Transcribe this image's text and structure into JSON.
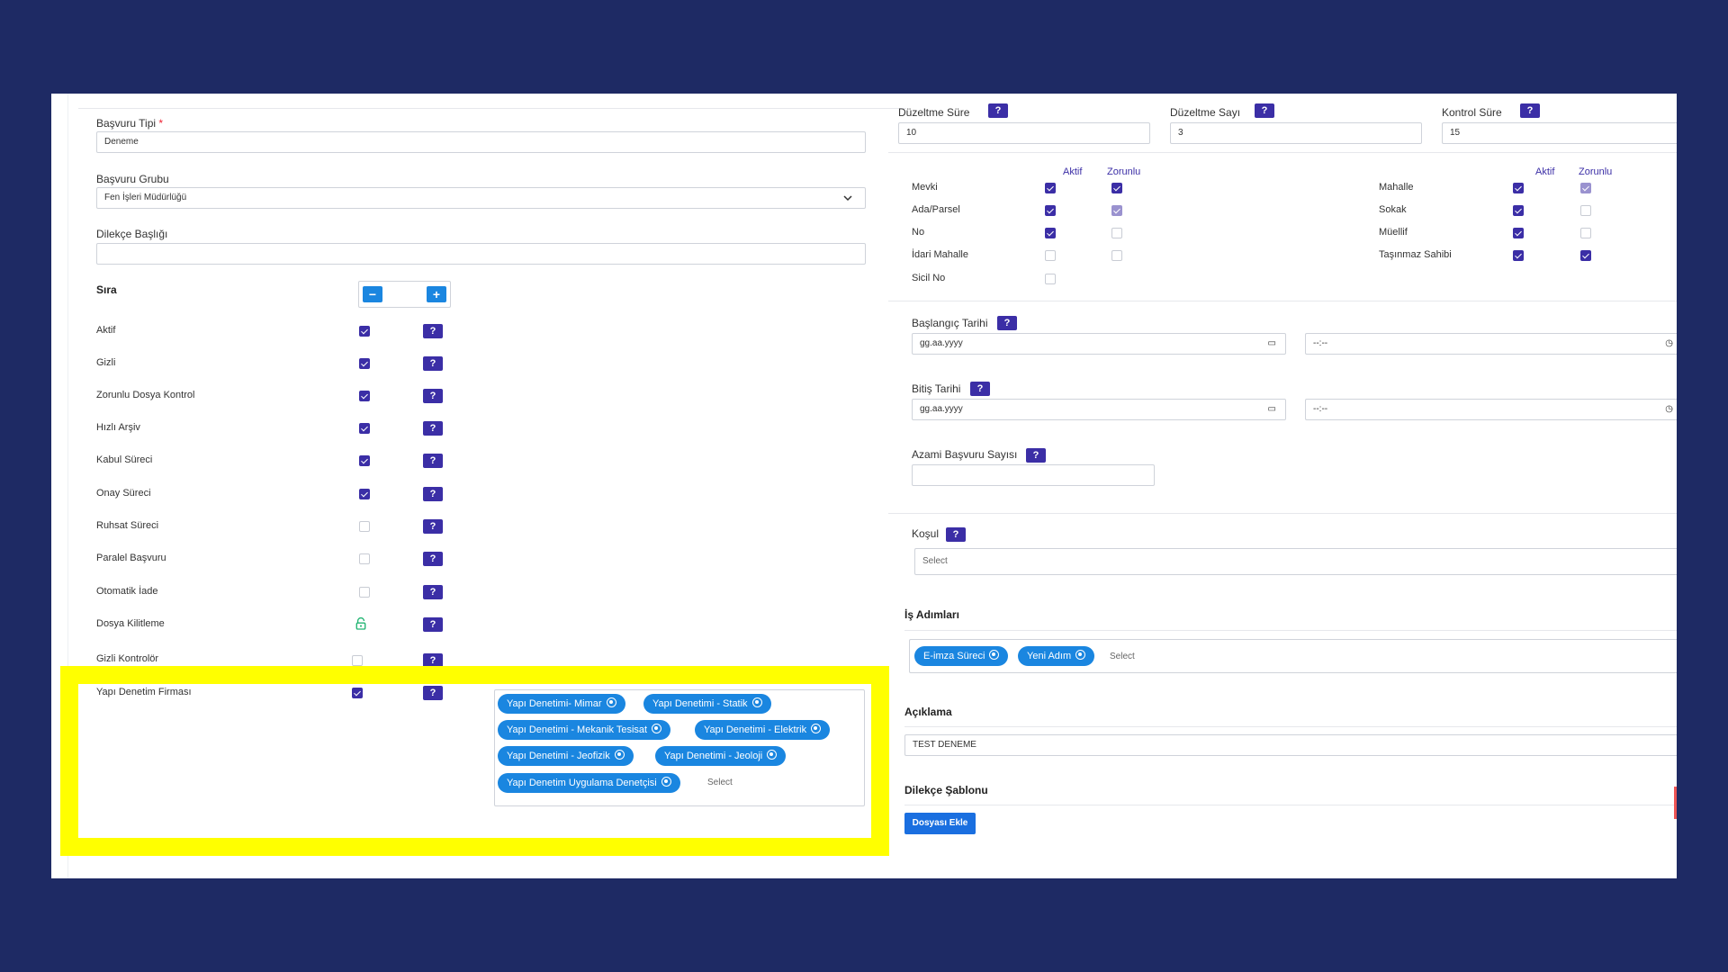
{
  "left": {
    "basvuru_tipi": {
      "label": "Başvuru Tipi",
      "required": "*",
      "value": "Deneme"
    },
    "basvuru_grubu": {
      "label": "Başvuru Grubu",
      "value": "Fen İşleri Müdürlüğü"
    },
    "dilekce_basligi": {
      "label": "Dilekçe Başlığı",
      "value": ""
    },
    "sira": {
      "label": "Sıra",
      "minus": "−",
      "plus": "+"
    },
    "help_glyph": "?",
    "rows": [
      {
        "label": "Aktif",
        "checked": true
      },
      {
        "label": "Gizli",
        "checked": true
      },
      {
        "label": "Zorunlu Dosya Kontrol",
        "checked": true
      },
      {
        "label": "Hızlı Arşiv",
        "checked": true
      },
      {
        "label": "Kabul Süreci",
        "checked": true
      },
      {
        "label": "Onay Süreci",
        "checked": true
      },
      {
        "label": "Ruhsat Süreci",
        "checked": false
      },
      {
        "label": "Paralel Başvuru",
        "checked": false
      },
      {
        "label": "Otomatik İade",
        "checked": false
      },
      {
        "label": "Dosya Kilitleme",
        "icon": "unlock-icon"
      },
      {
        "label": "Gizli Kontrolör",
        "checked": false
      }
    ],
    "yapi_denetim": {
      "label": "Yapı Denetim Firması",
      "checked": true,
      "tags": [
        "Yapı Denetimi- Mimar",
        "Yapı Denetimi - Statik",
        "Yapı Denetimi - Mekanik Tesisat",
        "Yapı Denetimi - Elektrik",
        "Yapı Denetimi - Jeofizik",
        "Yapı Denetimi - Jeoloji",
        "Yapı Denetim Uygulama Denetçisi"
      ],
      "placeholder": "Select"
    }
  },
  "right": {
    "duzeltme_sure": {
      "label": "Düzeltme Süre",
      "value": "10"
    },
    "duzeltme_sayi": {
      "label": "Düzeltme Sayı",
      "value": "3"
    },
    "kontrol_sure": {
      "label": "Kontrol Süre",
      "value": "15"
    },
    "col_aktif": "Aktif",
    "col_zorunlu": "Zorunlu",
    "fields_left": [
      {
        "label": "Mevki",
        "aktif": true,
        "zorunlu": true
      },
      {
        "label": "Ada/Parsel",
        "aktif": true,
        "zorunlu": true
      },
      {
        "label": "No",
        "aktif": true,
        "zorunlu": false
      },
      {
        "label": "İdari Mahalle",
        "aktif": false,
        "zorunlu": false
      },
      {
        "label": "Sicil No",
        "aktif": false
      }
    ],
    "fields_right": [
      {
        "label": "Mahalle",
        "aktif": true,
        "zorunlu": true
      },
      {
        "label": "Sokak",
        "aktif": true,
        "zorunlu": false
      },
      {
        "label": "Müellif",
        "aktif": true,
        "zorunlu": false
      },
      {
        "label": "Taşınmaz Sahibi",
        "aktif": true,
        "zorunlu": true
      }
    ],
    "baslangic": {
      "label": "Başlangıç Tarihi",
      "date": "gg.aa.yyyy",
      "time": "--:--"
    },
    "bitis": {
      "label": "Bitiş Tarihi",
      "date": "gg.aa.yyyy",
      "time": "--:--"
    },
    "azami": {
      "label": "Azami Başvuru Sayısı",
      "value": ""
    },
    "kosul": {
      "label": "Koşul",
      "placeholder": "Select"
    },
    "is_adimlari": {
      "label": "İş Adımları",
      "tags": [
        "E-imza Süreci",
        "Yeni Adım"
      ],
      "placeholder": "Select"
    },
    "aciklama": {
      "label": "Açıklama",
      "value": "TEST DENEME"
    },
    "dilekce_sablonu": {
      "label": "Dilekçe Şablonu",
      "button": "Dosyası Ekle"
    }
  }
}
